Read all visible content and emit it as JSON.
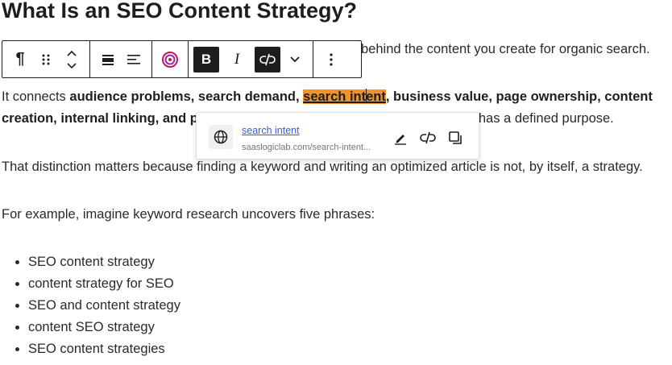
{
  "heading": "What Is an SEO Content Strategy?",
  "para1_tail": "behind the content you create for organic search.",
  "para2": {
    "intro": "It connects ",
    "bold_a": "audience problems, search demand, ",
    "link_a": "search int",
    "link_b": "ent",
    "bold_b": ", business value, page ownership, content",
    "line2_bold": "creation, internal linking, and p",
    "line2_tail": "has a defined purpose."
  },
  "para3": "That distinction matters because finding a keyword and writing an optimized article is not, by itself, a strategy.",
  "para4": "For example, imagine keyword research uncovers five phrases:",
  "list": [
    "SEO content strategy",
    "content strategy for SEO",
    "SEO and content strategy",
    "content SEO strategy",
    "SEO content strategies"
  ],
  "toolbar": {
    "paragraph_symbol": "¶",
    "bold_label": "B",
    "italic_label": "I"
  },
  "link_popover": {
    "title": "search intent",
    "url": "saaslogiclab.com/search-intent..."
  },
  "colors": {
    "highlight": "#f0932b",
    "link": "#3858e9"
  }
}
